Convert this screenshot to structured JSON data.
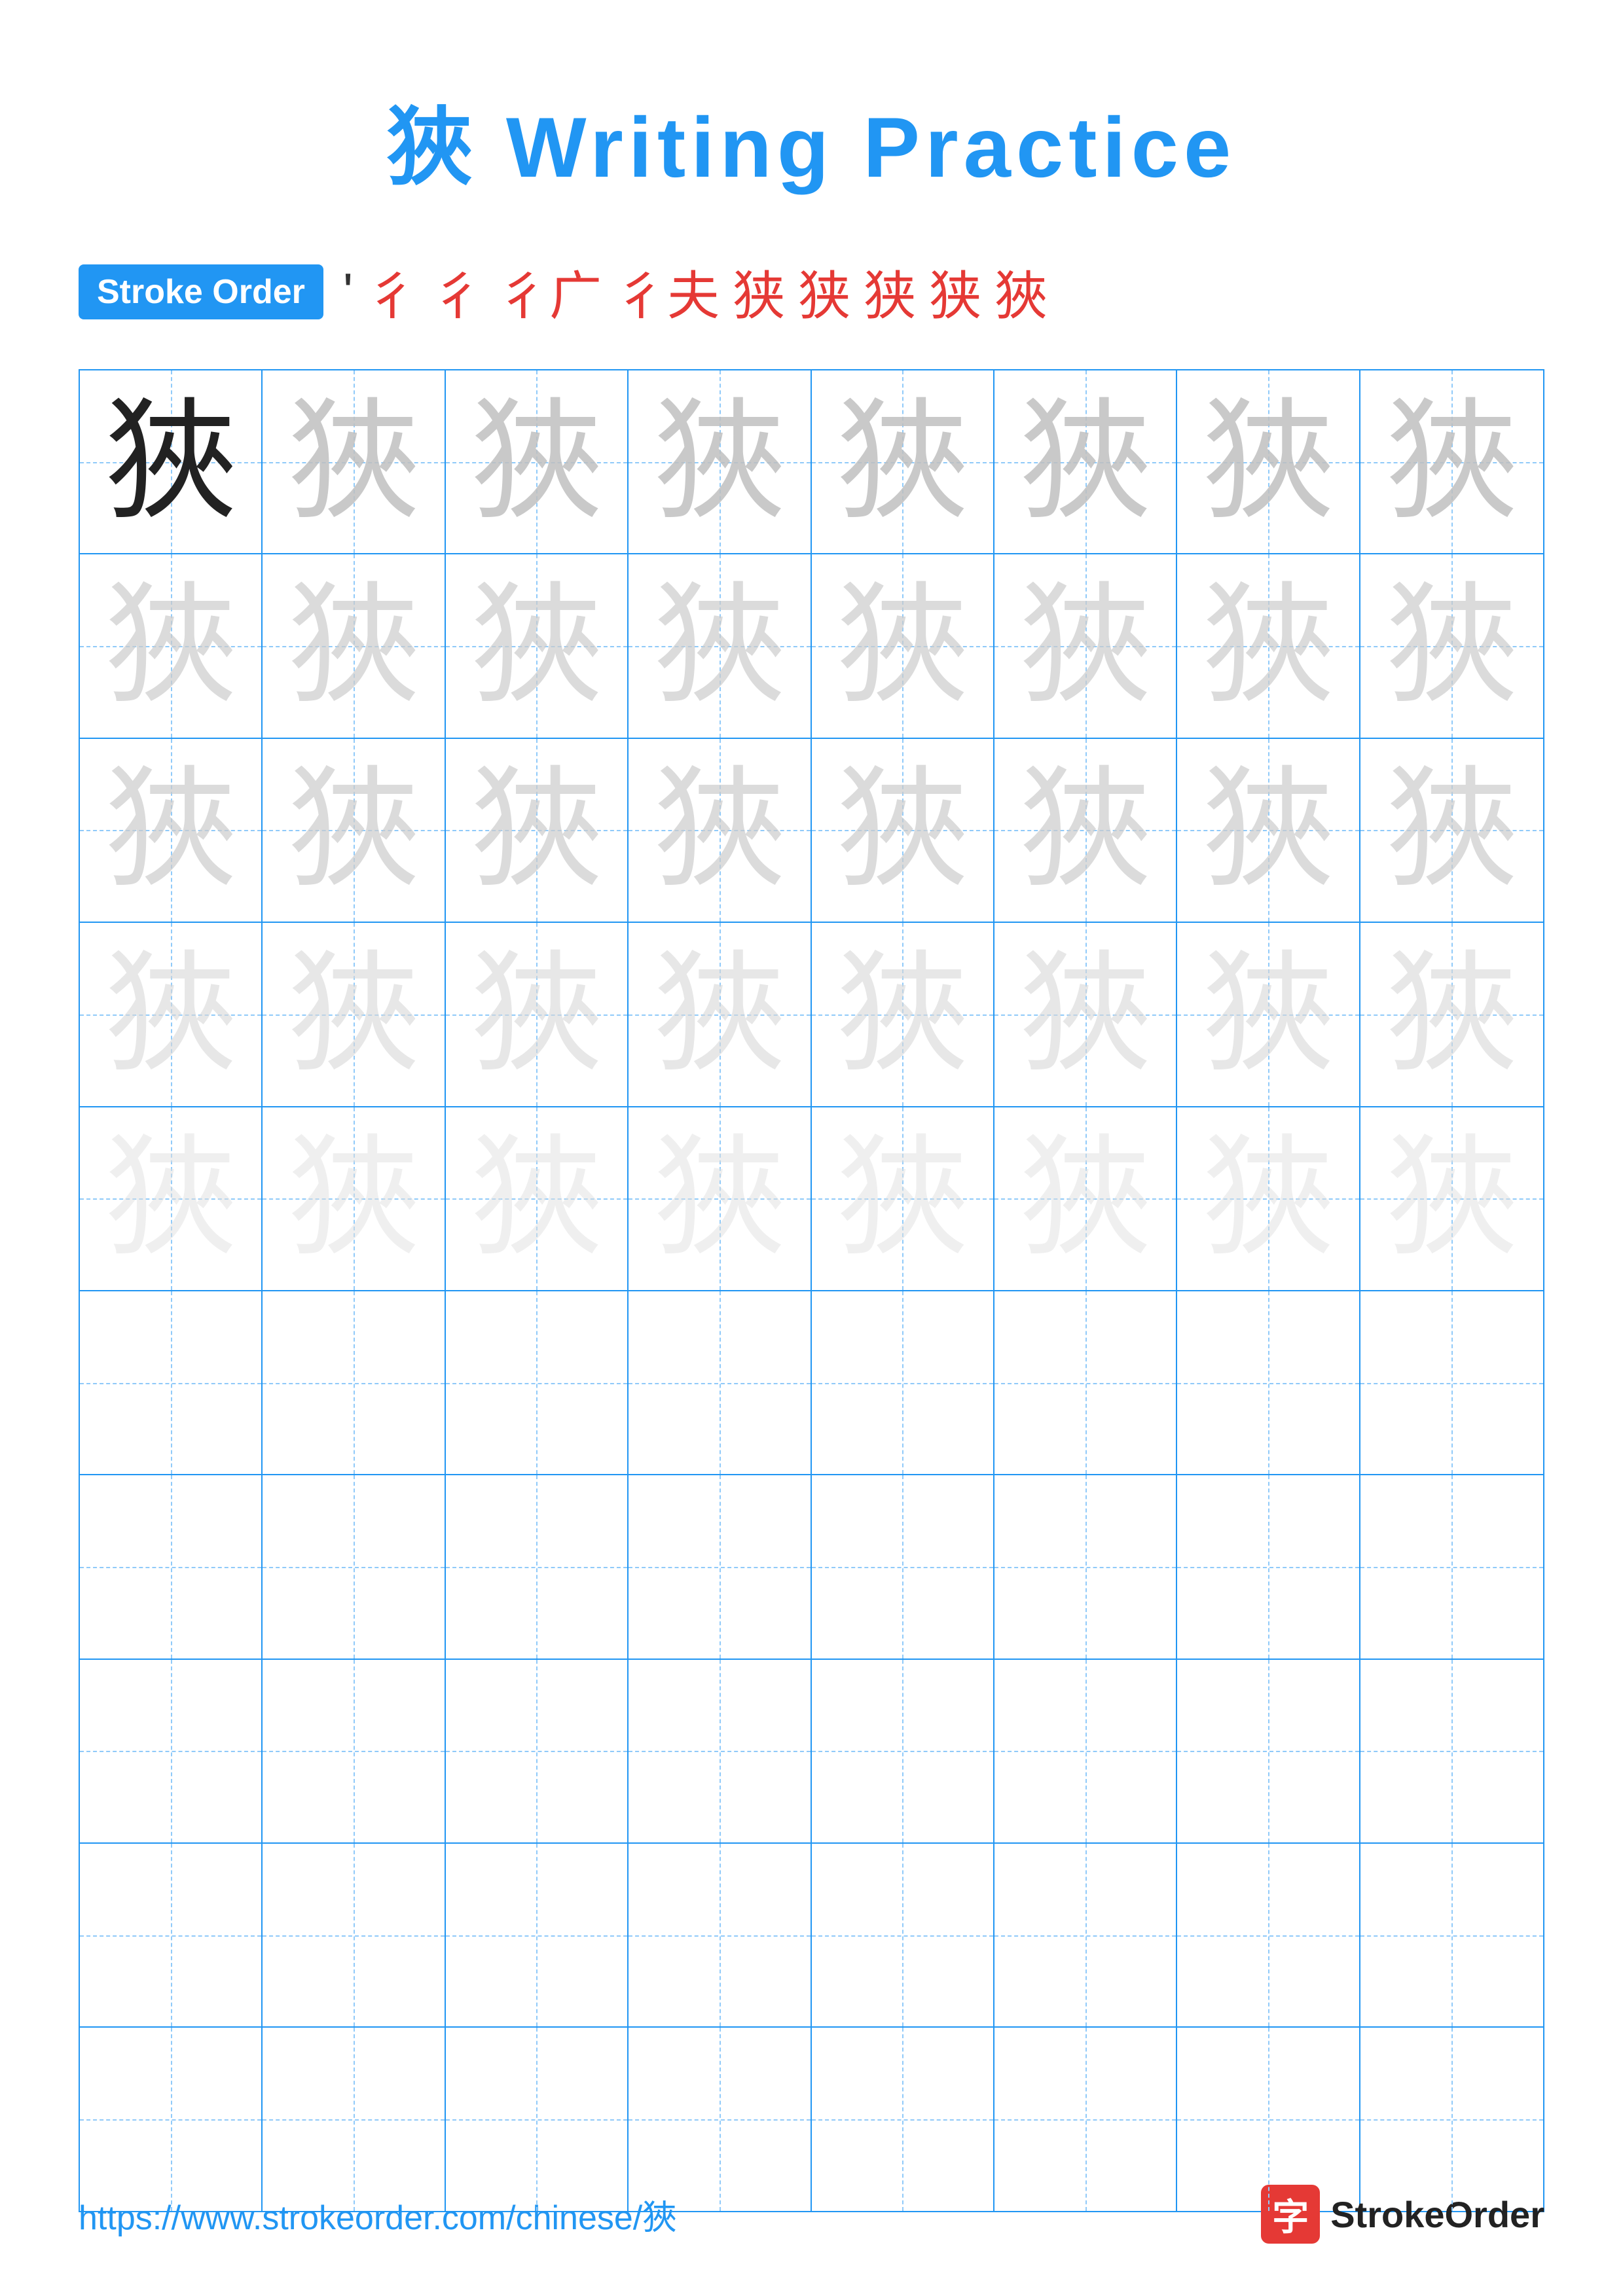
{
  "title": "狹 Writing Practice",
  "stroke_order": {
    "badge_label": "Stroke Order",
    "strokes": [
      "'",
      "彳",
      "彳",
      "彳广",
      "彳夫",
      "狭",
      "狭",
      "狭",
      "狭",
      "狭"
    ]
  },
  "character": "狹",
  "grid": {
    "rows": 10,
    "cols": 8,
    "filled_rows": 5,
    "empty_rows": 5
  },
  "footer": {
    "url": "https://www.strokeorder.com/chinese/狹",
    "logo_char": "字",
    "logo_text": "StrokeOrder"
  }
}
